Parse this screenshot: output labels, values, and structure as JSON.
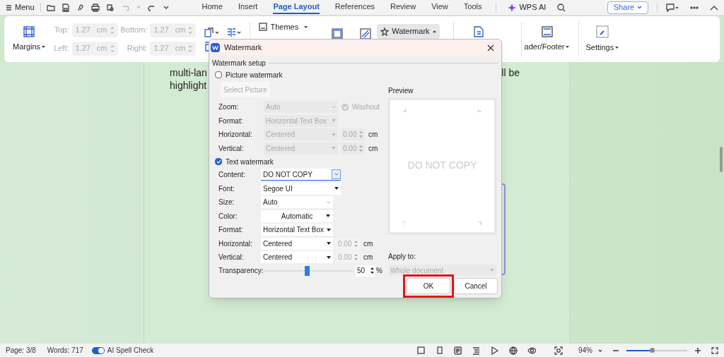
{
  "menu_bar": {
    "menu_label": "Menu",
    "tabs": [
      {
        "label": "Home",
        "selected": false
      },
      {
        "label": "Insert",
        "selected": false
      },
      {
        "label": "Page Layout",
        "selected": true
      },
      {
        "label": "References",
        "selected": false
      },
      {
        "label": "Review",
        "selected": false
      },
      {
        "label": "View",
        "selected": false
      },
      {
        "label": "Tools",
        "selected": false
      }
    ],
    "ai_label": "WPS AI",
    "share_label": "Share"
  },
  "ribbon": {
    "margins_label": "Margins",
    "margin_fields": [
      {
        "label": "Top:",
        "value": "1.27",
        "unit": "cm"
      },
      {
        "label": "Bottom:",
        "value": "1.27",
        "unit": "cm"
      },
      {
        "label": "Left:",
        "value": "1.27",
        "unit": "cm"
      },
      {
        "label": "Right:",
        "value": "1.27",
        "unit": "cm"
      }
    ],
    "themes_label": "Themes",
    "watermark_label": "Watermark",
    "watermark_selected": true,
    "header_footer_label": "ader/Footer",
    "settings_label": "Settings"
  },
  "document": {
    "lines": [
      {
        "left": "multi-lan",
        "right": "ll be"
      },
      {
        "left": "highlight"
      }
    ]
  },
  "dialog": {
    "title": "Watermark",
    "section_label": "Watermark setup",
    "picture_watermark": {
      "label": "Picture watermark",
      "checked": false
    },
    "select_picture_label": "Select Picture",
    "picture_fields": [
      {
        "label": "Zoom:",
        "value": "Auto",
        "kind": "zoom"
      },
      {
        "label": "Format:",
        "value": "Horizontal Text Box",
        "kind": "select"
      },
      {
        "label": "Horizontal:",
        "value": "Centered",
        "kind": "spin",
        "spin_value": "0.00",
        "unit": "cm"
      },
      {
        "label": "Vertical:",
        "value": "Centered",
        "kind": "spin",
        "spin_value": "0.00",
        "unit": "cm"
      }
    ],
    "washout": {
      "label": "Washout",
      "checked": true
    },
    "text_watermark": {
      "label": "Text watermark",
      "checked": true
    },
    "text_fields": [
      {
        "label": "Content:",
        "value": "DO NOT COPY",
        "kind": "text"
      },
      {
        "label": "Font:",
        "value": "Segoe UI",
        "kind": "select"
      },
      {
        "label": "Size:",
        "value": "Auto",
        "kind": "combo"
      },
      {
        "label": "Color:",
        "value": "Automatic",
        "kind": "color"
      },
      {
        "label": "Format:",
        "value": "Horizontal Text Box",
        "kind": "select"
      },
      {
        "label": "Horizontal:",
        "value": "Centered",
        "kind": "spin",
        "spin_value": "0.00",
        "unit": "cm"
      },
      {
        "label": "Vertical:",
        "value": "Centered",
        "kind": "spin",
        "spin_value": "0.00",
        "unit": "cm"
      }
    ],
    "transparency": {
      "label": "Transparency:",
      "level": 0.5,
      "value": "50",
      "unit": "%"
    },
    "preview": {
      "label": "Preview",
      "text": "DO NOT COPY"
    },
    "apply_to": {
      "label": "Apply to:",
      "value": "Whole document"
    },
    "buttons": [
      {
        "label": "OK",
        "highlighted": true
      },
      {
        "label": "Cancel",
        "highlighted": false
      }
    ]
  },
  "status_bar": {
    "page": "Page: 3/8",
    "words": "Words: 717",
    "spell_check": {
      "label": "AI Spell Check",
      "on": true
    },
    "zoom": "94%",
    "zoom_slider": {
      "level": 0.42
    }
  }
}
